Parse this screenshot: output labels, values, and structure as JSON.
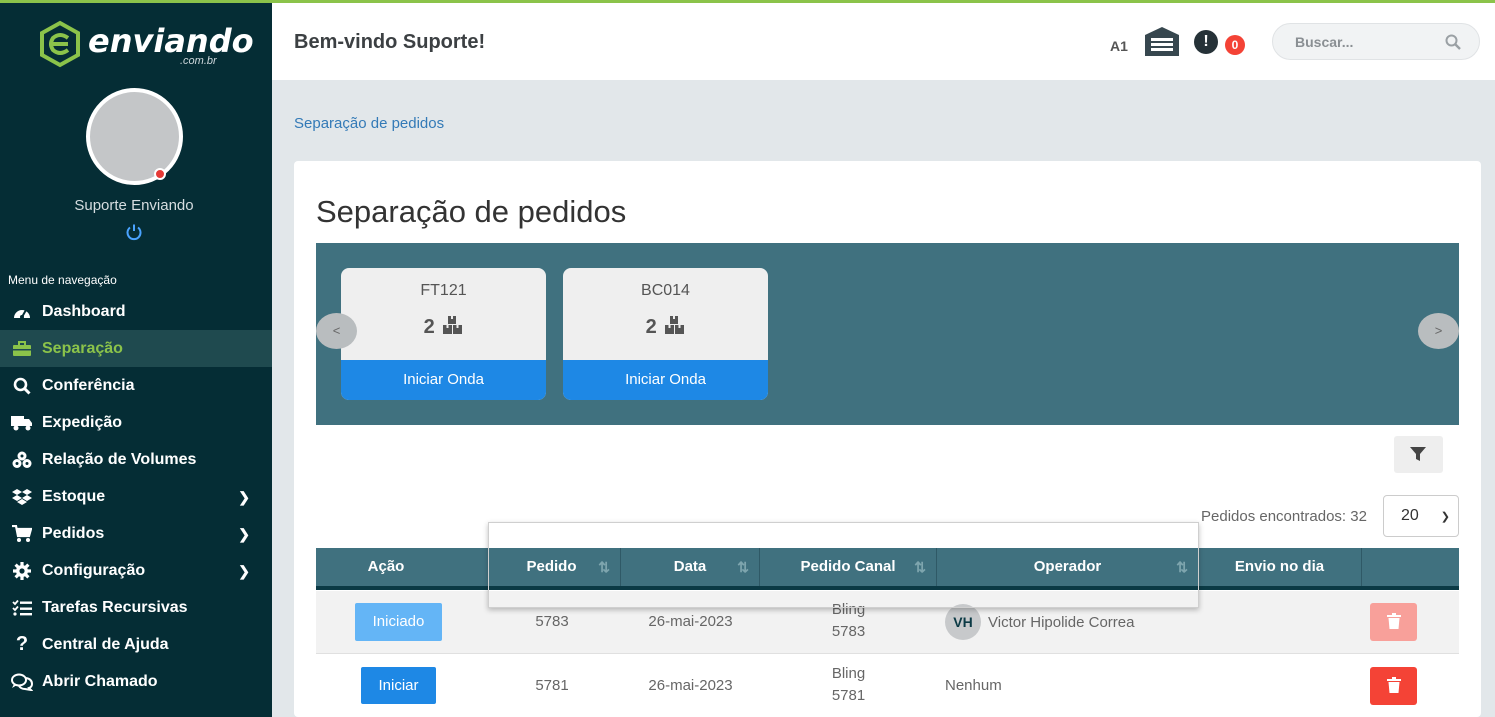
{
  "brand": {
    "name": "enviando",
    "sub": ".com.br",
    "accent": "#8bc34a"
  },
  "user": {
    "name": "Suporte Enviando",
    "status_color": "#e53935"
  },
  "nav": {
    "title": "Menu de navegação",
    "items": [
      {
        "label": "Dashboard",
        "icon": "gauge-icon",
        "active": false,
        "submenu": false
      },
      {
        "label": "Separação",
        "icon": "toolbox-icon",
        "active": true,
        "submenu": false
      },
      {
        "label": "Conferência",
        "icon": "search-icon",
        "active": false,
        "submenu": false
      },
      {
        "label": "Expedição",
        "icon": "truck-icon",
        "active": false,
        "submenu": false
      },
      {
        "label": "Relação de Volumes",
        "icon": "boxes-icon",
        "active": false,
        "submenu": false
      },
      {
        "label": "Estoque",
        "icon": "dropbox-icon",
        "active": false,
        "submenu": true
      },
      {
        "label": "Pedidos",
        "icon": "cart-icon",
        "active": false,
        "submenu": true
      },
      {
        "label": "Configuração",
        "icon": "gear-icon",
        "active": false,
        "submenu": true
      },
      {
        "label": "Tarefas Recursivas",
        "icon": "tasks-icon",
        "active": false,
        "submenu": false
      },
      {
        "label": "Central de Ajuda",
        "icon": "question-icon",
        "active": false,
        "submenu": false
      },
      {
        "label": "Abrir Chamado",
        "icon": "comments-icon",
        "active": false,
        "submenu": false
      }
    ]
  },
  "header": {
    "welcome": "Bem-vindo Suporte!",
    "warehouse_code": "A1",
    "alert_icon": "!",
    "notifications": "0",
    "search_placeholder": "Buscar..."
  },
  "breadcrumb": "Separação de pedidos",
  "page": {
    "title": "Separação de pedidos",
    "waves": [
      {
        "code": "FT121",
        "count": "2",
        "button": "Iniciar Onda"
      },
      {
        "code": "BC014",
        "count": "2",
        "button": "Iniciar Onda"
      }
    ],
    "prev": "<",
    "next": ">",
    "found_label": "Pedidos encontrados: 32",
    "per_page": "20"
  },
  "table": {
    "columns": [
      "Ação",
      "Pedido",
      "Data",
      "Pedido Canal",
      "Operador",
      "Envio no dia",
      ""
    ],
    "rows": [
      {
        "action": "Iniciado",
        "pedido": "5783",
        "data": "26-mai-2023",
        "canal": "Bling",
        "canal_num": "5783",
        "operador_initials": "VH",
        "operador": "Victor Hipolide Correa",
        "envio": ""
      },
      {
        "action": "Iniciar",
        "pedido": "5781",
        "data": "26-mai-2023",
        "canal": "Bling",
        "canal_num": "5781",
        "operador_initials": "",
        "operador": "Nenhum",
        "envio": ""
      }
    ]
  },
  "colors": {
    "sidebar": "#052d35",
    "table_header": "#40717f",
    "primary": "#1e88e5",
    "danger": "#f44336"
  }
}
